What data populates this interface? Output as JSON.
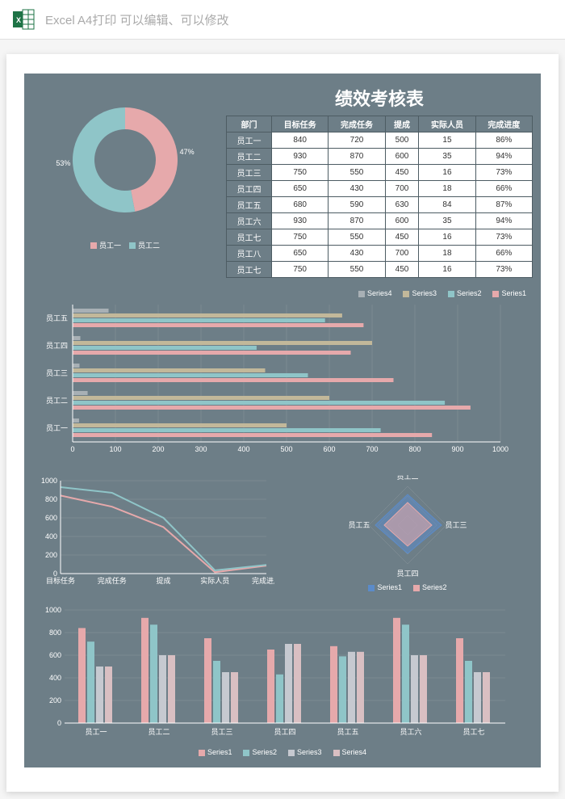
{
  "topbar_text": "Excel A4打印 可以编辑、可以修改",
  "title": "绩效考核表",
  "colors": {
    "pink": "#e6a9ab",
    "teal": "#8fc5c8",
    "grey": "#a8b0b5",
    "sand": "#c2b89a",
    "panel": "#6d7e87"
  },
  "table": {
    "headers": [
      "部门",
      "目标任务",
      "完成任务",
      "提成",
      "实际人员",
      "完成进度"
    ],
    "rows": [
      [
        "员工一",
        "840",
        "720",
        "500",
        "15",
        "86%"
      ],
      [
        "员工二",
        "930",
        "870",
        "600",
        "35",
        "94%"
      ],
      [
        "员工三",
        "750",
        "550",
        "450",
        "16",
        "73%"
      ],
      [
        "员工四",
        "650",
        "430",
        "700",
        "18",
        "66%"
      ],
      [
        "员工五",
        "680",
        "590",
        "630",
        "84",
        "87%"
      ],
      [
        "员工六",
        "930",
        "870",
        "600",
        "35",
        "94%"
      ],
      [
        "员工七",
        "750",
        "550",
        "450",
        "16",
        "73%"
      ],
      [
        "员工八",
        "650",
        "430",
        "700",
        "18",
        "66%"
      ],
      [
        "员工七",
        "750",
        "550",
        "450",
        "16",
        "73%"
      ]
    ]
  },
  "donut": {
    "labels": [
      "员工一",
      "员工二"
    ],
    "values": [
      47,
      53
    ],
    "pct": [
      "47%",
      "53%"
    ]
  },
  "hbar": {
    "legend": [
      "Series4",
      "Series3",
      "Series2",
      "Series1"
    ],
    "categories": [
      "员工五",
      "员工四",
      "员工三",
      "员工二",
      "员工一"
    ],
    "series": [
      {
        "name": "Series4",
        "color": "#a8b0b5",
        "values": [
          84,
          18,
          16,
          35,
          15
        ]
      },
      {
        "name": "Series3",
        "color": "#c2b89a",
        "values": [
          630,
          700,
          450,
          600,
          500
        ]
      },
      {
        "name": "Series2",
        "color": "#8fc5c8",
        "values": [
          590,
          430,
          550,
          870,
          720
        ]
      },
      {
        "name": "Series1",
        "color": "#e6a9ab",
        "values": [
          680,
          650,
          750,
          930,
          840
        ]
      }
    ],
    "xticks": [
      0,
      100,
      200,
      300,
      400,
      500,
      600,
      700,
      800,
      900,
      1000
    ]
  },
  "line": {
    "categories": [
      "目标任务",
      "完成任务",
      "提成",
      "实际人员",
      "完成进度"
    ],
    "series": [
      {
        "name": "员工一",
        "color": "#e6a9ab",
        "values": [
          840,
          720,
          500,
          15,
          86
        ]
      },
      {
        "name": "员工二",
        "color": "#8fc5c8",
        "values": [
          930,
          870,
          600,
          35,
          94
        ]
      }
    ],
    "yticks": [
      0,
      200,
      400,
      600,
      800,
      1000
    ]
  },
  "radar": {
    "axes": [
      "员工二",
      "员工三",
      "员工四",
      "员工五"
    ],
    "legend": [
      "Series1",
      "Series2"
    ]
  },
  "vbar": {
    "categories": [
      "员工一",
      "员工二",
      "员工三",
      "员工四",
      "员工五",
      "员工六",
      "员工七"
    ],
    "series": [
      {
        "name": "Series1",
        "color": "#e6a9ab",
        "values": [
          840,
          930,
          750,
          650,
          680,
          930,
          750
        ]
      },
      {
        "name": "Series2",
        "color": "#8fc5c8",
        "values": [
          720,
          870,
          550,
          430,
          590,
          870,
          550
        ]
      },
      {
        "name": "Series3",
        "color": "#c6c9d0",
        "values": [
          500,
          600,
          450,
          700,
          630,
          600,
          450
        ]
      },
      {
        "name": "Series4",
        "color": "#d9bfc2",
        "values": [
          500,
          600,
          450,
          700,
          630,
          600,
          450
        ]
      }
    ],
    "yticks": [
      0,
      200,
      400,
      600,
      800,
      1000
    ],
    "legend": [
      "Series1",
      "Series2",
      "Series3",
      "Series4"
    ]
  },
  "chart_data": [
    {
      "type": "pie",
      "title": "",
      "values": [
        47,
        53
      ],
      "categories": [
        "员工一",
        "员工二"
      ]
    },
    {
      "type": "table",
      "title": "绩效考核表",
      "headers": [
        "部门",
        "目标任务",
        "完成任务",
        "提成",
        "实际人员",
        "完成进度"
      ],
      "rows": [
        [
          "员工一",
          840,
          720,
          500,
          15,
          "86%"
        ],
        [
          "员工二",
          930,
          870,
          600,
          35,
          "94%"
        ],
        [
          "员工三",
          750,
          550,
          450,
          16,
          "73%"
        ],
        [
          "员工四",
          650,
          430,
          700,
          18,
          "66%"
        ],
        [
          "员工五",
          680,
          590,
          630,
          84,
          "87%"
        ],
        [
          "员工六",
          930,
          870,
          600,
          35,
          "94%"
        ],
        [
          "员工七",
          750,
          550,
          450,
          16,
          "73%"
        ],
        [
          "员工八",
          650,
          430,
          700,
          18,
          "66%"
        ],
        [
          "员工七",
          750,
          550,
          450,
          16,
          "73%"
        ]
      ]
    },
    {
      "type": "bar",
      "orientation": "horizontal",
      "categories": [
        "员工五",
        "员工四",
        "员工三",
        "员工二",
        "员工一"
      ],
      "series": [
        {
          "name": "Series4",
          "values": [
            84,
            18,
            16,
            35,
            15
          ]
        },
        {
          "name": "Series3",
          "values": [
            630,
            700,
            450,
            600,
            500
          ]
        },
        {
          "name": "Series2",
          "values": [
            590,
            430,
            550,
            870,
            720
          ]
        },
        {
          "name": "Series1",
          "values": [
            680,
            650,
            750,
            930,
            840
          ]
        }
      ],
      "xlabel": "",
      "ylabel": "",
      "xlim": [
        0,
        1000
      ]
    },
    {
      "type": "line",
      "categories": [
        "目标任务",
        "完成任务",
        "提成",
        "实际人员",
        "完成进度"
      ],
      "series": [
        {
          "name": "员工一",
          "values": [
            840,
            720,
            500,
            15,
            86
          ]
        },
        {
          "name": "员工二",
          "values": [
            930,
            870,
            600,
            35,
            94
          ]
        }
      ],
      "ylim": [
        0,
        1000
      ]
    },
    {
      "type": "bar",
      "orientation": "vertical",
      "categories": [
        "员工一",
        "员工二",
        "员工三",
        "员工四",
        "员工五",
        "员工六",
        "员工七"
      ],
      "series": [
        {
          "name": "Series1",
          "values": [
            840,
            930,
            750,
            650,
            680,
            930,
            750
          ]
        },
        {
          "name": "Series2",
          "values": [
            720,
            870,
            550,
            430,
            590,
            870,
            550
          ]
        },
        {
          "name": "Series3",
          "values": [
            500,
            600,
            450,
            700,
            630,
            600,
            450
          ]
        },
        {
          "name": "Series4",
          "values": [
            500,
            600,
            450,
            700,
            630,
            600,
            450
          ]
        }
      ],
      "ylim": [
        0,
        1000
      ]
    }
  ]
}
